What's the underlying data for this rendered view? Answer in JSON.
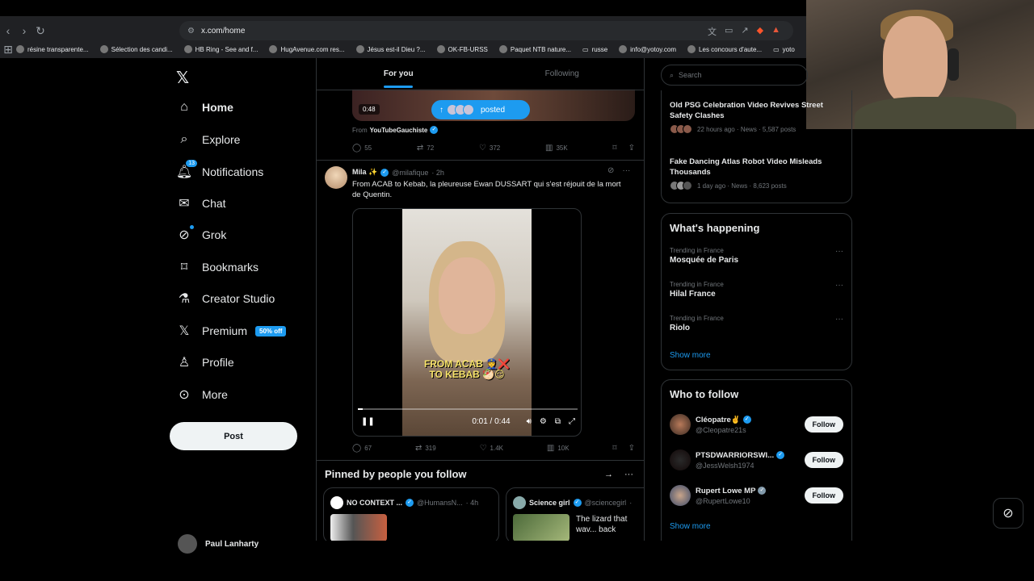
{
  "browser": {
    "url": "x.com/home",
    "bookmarks": [
      "résine transparente...",
      "Sélection des candi...",
      "HB Ring - See and f...",
      "HugAvenue.com res...",
      "Jésus est-il Dieu ?...",
      "OK-FB-URSS",
      "Paquet NTB nature...",
      "russe",
      "info@yotoy.com",
      "Les concours d'aute...",
      "yoto"
    ]
  },
  "nav": {
    "items": [
      {
        "label": "Home",
        "icon": "home-icon"
      },
      {
        "label": "Explore",
        "icon": "search-icon"
      },
      {
        "label": "Notifications",
        "icon": "bell-icon",
        "badge": "13"
      },
      {
        "label": "Chat",
        "icon": "mail-icon"
      },
      {
        "label": "Grok",
        "icon": "grok-icon"
      },
      {
        "label": "Bookmarks",
        "icon": "bookmark-icon"
      },
      {
        "label": "Creator Studio",
        "icon": "flask-icon"
      },
      {
        "label": "Premium",
        "icon": "x-icon",
        "badge": "50% off"
      },
      {
        "label": "Profile",
        "icon": "person-icon"
      },
      {
        "label": "More",
        "icon": "more-circle-icon"
      }
    ],
    "post_label": "Post",
    "account_name": "Paul Lanharty"
  },
  "feed": {
    "tabs": [
      "For you",
      "Following"
    ],
    "prev": {
      "duration": "0:48",
      "posted_label": "posted",
      "from_label": "From",
      "from_name": "YouTubeGauchiste",
      "stats": {
        "replies": "55",
        "reposts": "72",
        "likes": "372",
        "views": "35K"
      }
    },
    "tweet": {
      "name": "Mila ✨",
      "handle": "@milafique",
      "time": "· 2h",
      "text": "From ACAB to Kebab, la pleureuse Ewan DUSSART qui s'est réjouit de la mort de Quentin.",
      "video_caption": "FROM ACAB 👮❌\nTO KEBAB 🥙😏",
      "video_time": "0:01 / 0:44",
      "video_progress": 0.023,
      "stats": {
        "replies": "67",
        "reposts": "319",
        "likes": "1.4K",
        "views": "10K"
      }
    },
    "pinned": {
      "title": "Pinned by people you follow",
      "cards": [
        {
          "name": "NO CONTEXT ...",
          "handle": "@HumansN...",
          "time": "· 4h",
          "text": ""
        },
        {
          "name": "Science girl",
          "handle": "@sciencegirl",
          "time": "·",
          "text": "The lizard that wav... back"
        }
      ]
    }
  },
  "sidebar": {
    "search_placeholder": "Search",
    "news": [
      {
        "title": "Old PSG Celebration Video Revives Street Safety Clashes",
        "meta": "22 hours ago · News · 5,587 posts"
      },
      {
        "title": "Fake Dancing Atlas Robot Video Misleads Thousands",
        "meta": "1 day ago · News · 8,623 posts"
      }
    ],
    "happening": {
      "title": "What's happening",
      "trends": [
        {
          "context": "Trending in France",
          "name": "Mosquée de Paris"
        },
        {
          "context": "Trending in France",
          "name": "Hilal France"
        },
        {
          "context": "Trending in France",
          "name": "Riolo"
        }
      ],
      "show_more": "Show more"
    },
    "who_to_follow": {
      "title": "Who to follow",
      "users": [
        {
          "name": "Cléopatre✌️",
          "handle": "@Cleopatre21s"
        },
        {
          "name": "PTSDWARRIORSWI...",
          "handle": "@JessWelsh1974"
        },
        {
          "name": "Rupert Lowe MP",
          "handle": "@RupertLowe10"
        }
      ],
      "follow_label": "Follow",
      "show_more": "Show more"
    }
  },
  "colors": {
    "accent": "#1d9bf0",
    "bg": "#000000",
    "border": "#2f3336",
    "muted": "#71767b"
  }
}
